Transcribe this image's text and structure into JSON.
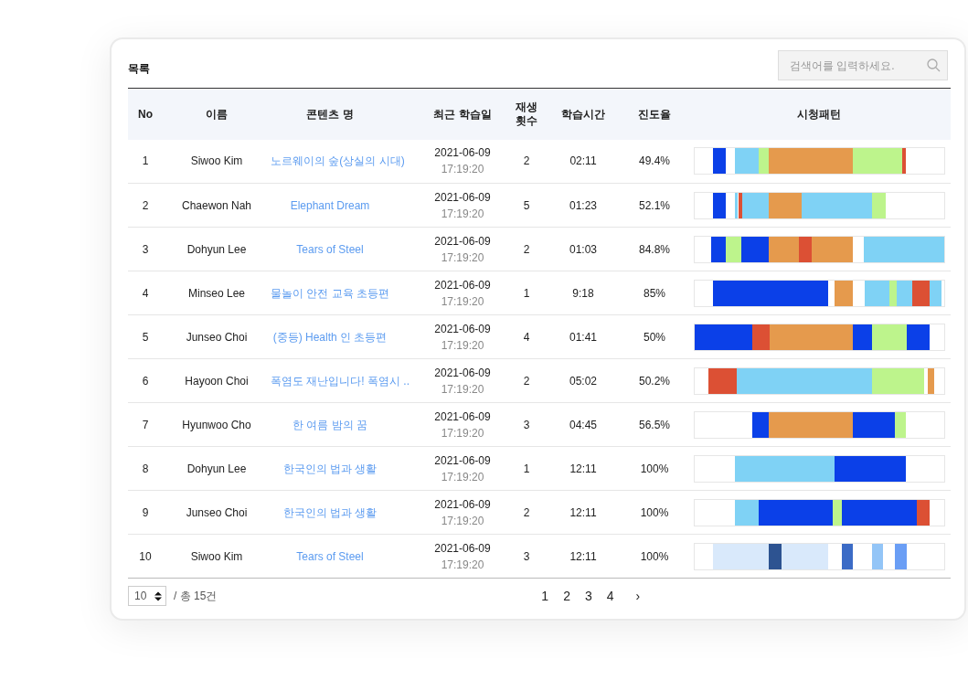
{
  "title": "목록",
  "search": {
    "placeholder": "검색어를 입력하세요."
  },
  "table": {
    "columns": [
      "No",
      "이름",
      "콘텐츠 명",
      "최근 학습일",
      "재생\n횟수",
      "학습시간",
      "진도율",
      "시청패턴"
    ],
    "rows": [
      {
        "no": "1",
        "name": "Siwoo Kim",
        "content": "노르웨이의 숲(상실의 시대)",
        "date": "2021-06-09",
        "time_of_day": "17:19:20",
        "plays": "2",
        "study_time": "02:11",
        "progress": "49.4%"
      },
      {
        "no": "2",
        "name": "Chaewon Nah",
        "content": "Elephant Dream",
        "date": "2021-06-09",
        "time_of_day": "17:19:20",
        "plays": "5",
        "study_time": "01:23",
        "progress": "52.1%"
      },
      {
        "no": "3",
        "name": "Dohyun Lee",
        "content": "Tears of Steel",
        "date": "2021-06-09",
        "time_of_day": "17:19:20",
        "plays": "2",
        "study_time": "01:03",
        "progress": "84.8%"
      },
      {
        "no": "4",
        "name": "Minseo Lee",
        "content": "물놀이 안전 교육 초등편",
        "date": "2021-06-09",
        "time_of_day": "17:19:20",
        "plays": "1",
        "study_time": "9:18",
        "progress": "85%"
      },
      {
        "no": "5",
        "name": "Junseo Choi",
        "content": "(중등) Health 인 초등편",
        "date": "2021-06-09",
        "time_of_day": "17:19:20",
        "plays": "4",
        "study_time": "01:41",
        "progress": "50%"
      },
      {
        "no": "6",
        "name": "Hayoon Choi",
        "content": "폭염도 재난입니다! 폭염시 ..",
        "date": "2021-06-09",
        "time_of_day": "17:19:20",
        "plays": "2",
        "study_time": "05:02",
        "progress": "50.2%"
      },
      {
        "no": "7",
        "name": "Hyunwoo Cho",
        "content": "한 여름 밤의 꿈",
        "date": "2021-06-09",
        "time_of_day": "17:19:20",
        "plays": "3",
        "study_time": "04:45",
        "progress": "56.5%"
      },
      {
        "no": "8",
        "name": "Dohyun Lee",
        "content": "한국인의 법과 생활",
        "date": "2021-06-09",
        "time_of_day": "17:19:20",
        "plays": "1",
        "study_time": "12:11",
        "progress": "100%"
      },
      {
        "no": "9",
        "name": "Junseo Choi",
        "content": "한국인의 법과 생활",
        "date": "2021-06-09",
        "time_of_day": "17:19:20",
        "plays": "2",
        "study_time": "12:11",
        "progress": "100%"
      },
      {
        "no": "10",
        "name": "Siwoo Kim",
        "content": "Tears of Steel",
        "date": "2021-06-09",
        "time_of_day": "17:19:20",
        "plays": "3",
        "study_time": "12:11",
        "progress": "100%"
      }
    ]
  },
  "footer": {
    "page_size": "10",
    "total": "/ 총 15건",
    "pages": [
      "1",
      "2",
      "3",
      "4"
    ],
    "next": "›"
  }
}
